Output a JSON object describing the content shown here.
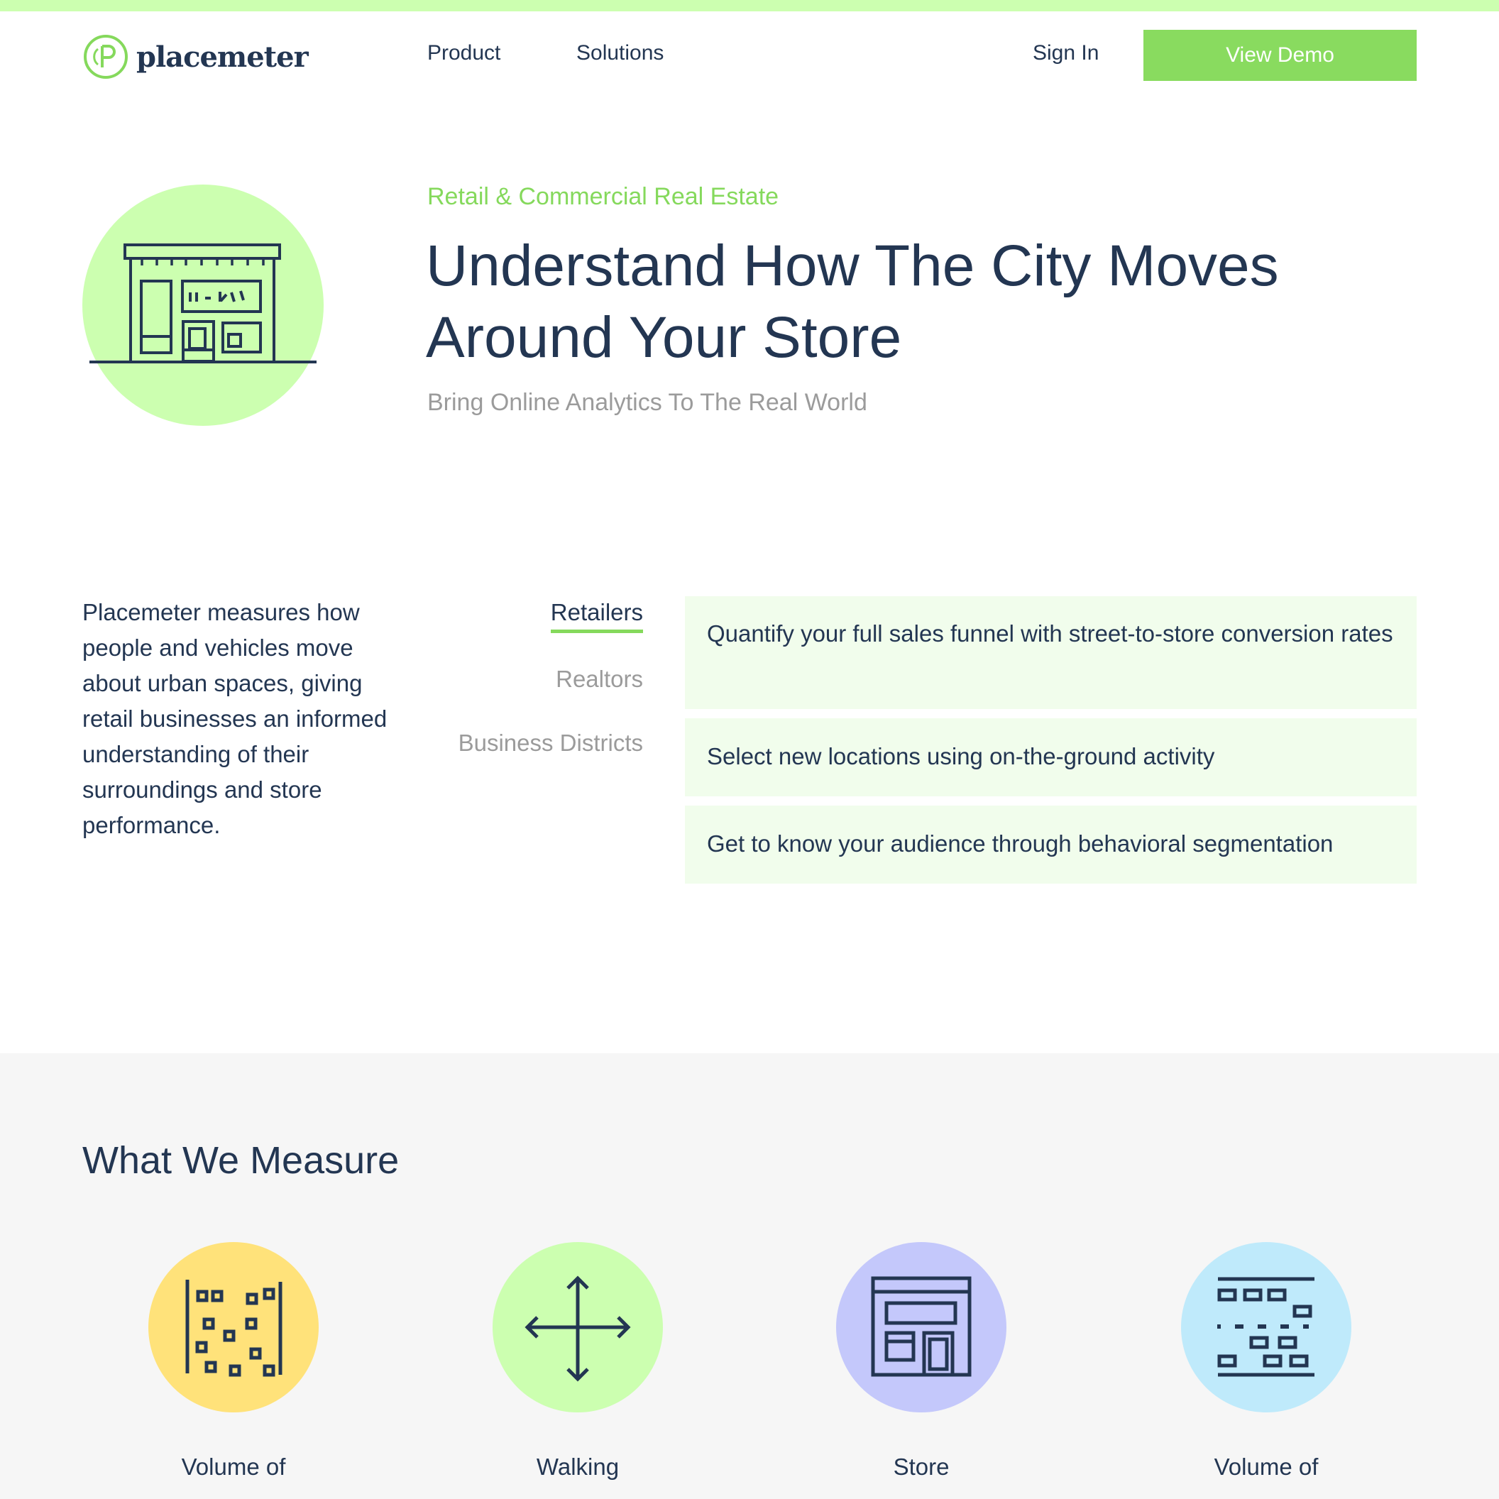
{
  "colors": {
    "accent_green": "#89db5f",
    "light_green": "#ccffb0",
    "navy": "#233652",
    "gray_text": "#9b9b9b",
    "card_bg": "#f1fdec",
    "section_bg": "#f6f6f6",
    "yellow": "#ffe27a",
    "lavender": "#c4c8fb",
    "sky": "#bfeafb"
  },
  "header": {
    "logo_icon": "placemeter-logo-icon",
    "logo_text": "placemeter",
    "nav": [
      {
        "label": "Product"
      },
      {
        "label": "Solutions"
      }
    ],
    "sign_in": "Sign In",
    "cta": "View Demo"
  },
  "hero": {
    "icon": "storefront-icon",
    "eyebrow": "Retail & Commercial Real Estate",
    "headline_line1": "Understand How The City Moves",
    "headline_line2": "Around Your Store",
    "subtitle": "Bring Online Analytics To The Real World"
  },
  "intro": {
    "text": "Placemeter measures how people and vehicles move about urban spaces, giving retail businesses an informed understanding of their surroundings and store performance."
  },
  "tabs": [
    {
      "label": "Retailers",
      "active": true
    },
    {
      "label": "Realtors",
      "active": false
    },
    {
      "label": "Business Districts",
      "active": false
    }
  ],
  "features": [
    {
      "text": "Quantify your full sales funnel with street-to-store conversion rates"
    },
    {
      "text": "Select new locations using on-the-ground activity"
    },
    {
      "text": "Get to know your audience through behavioral segmentation"
    }
  ],
  "measure": {
    "title": "What We Measure",
    "items": [
      {
        "label": "Volume of",
        "icon": "pedestrian-volume-icon"
      },
      {
        "label": "Walking",
        "icon": "walking-direction-icon"
      },
      {
        "label": "Store",
        "icon": "store-front-icon"
      },
      {
        "label": "Volume of",
        "icon": "vehicle-volume-icon"
      }
    ]
  }
}
